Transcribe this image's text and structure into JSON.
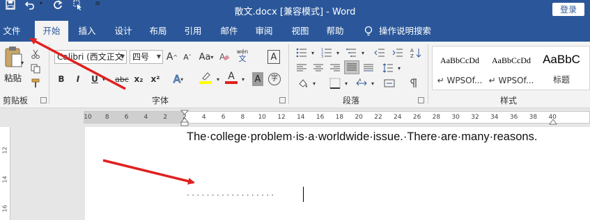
{
  "titlebar": {
    "title": "散文.docx [兼容模式] - Word",
    "login": "登录"
  },
  "tabs": [
    {
      "label": "文件"
    },
    {
      "label": "开始"
    },
    {
      "label": "插入"
    },
    {
      "label": "设计"
    },
    {
      "label": "布局"
    },
    {
      "label": "引用"
    },
    {
      "label": "邮件"
    },
    {
      "label": "审阅"
    },
    {
      "label": "视图"
    },
    {
      "label": "帮助"
    },
    {
      "label": "操作说明搜索"
    }
  ],
  "clipboard": {
    "paste": "粘贴",
    "group": "剪贴板"
  },
  "font": {
    "family": "Calibri (西文正文",
    "size": "四号",
    "group": "字体",
    "bold": "B",
    "italic": "I",
    "underline": "U",
    "strike": "abc",
    "subscript": "x₂",
    "superscript": "x²",
    "grow": "A",
    "shrink": "A",
    "case": "Aa",
    "phonetic": "wén",
    "phonetic_char": "文",
    "border_char": "A",
    "shade_char": "A",
    "enclose": "字"
  },
  "paragraph": {
    "group": "段落"
  },
  "styles": {
    "group": "样式",
    "items": [
      {
        "preview": "AaBbCcDd",
        "name": "↵ WPSOf..."
      },
      {
        "preview": "AaBbCcDd",
        "name": "↵ WPSOf..."
      },
      {
        "preview": "AaBbC",
        "name": "标题"
      }
    ]
  },
  "ruler": {
    "ticks": [
      "10",
      "8",
      "6",
      "4",
      "2",
      "2",
      "4",
      "6",
      "8",
      "10",
      "12",
      "14",
      "16",
      "18",
      "20",
      "22",
      "24",
      "26",
      "28",
      "30",
      "32",
      "34",
      "36",
      "38",
      "40"
    ]
  },
  "vruler": {
    "ticks": [
      "12",
      "14",
      "16"
    ]
  },
  "document": {
    "line1": "The·college·problem·is·a·worldwide·issue.·There·are·many·reasons.",
    "line2": "··················"
  },
  "colors": {
    "brand": "#2b579a",
    "highlight": "#ffff00",
    "font_color": "#e02020",
    "annotation_arrow": "#e02020"
  }
}
